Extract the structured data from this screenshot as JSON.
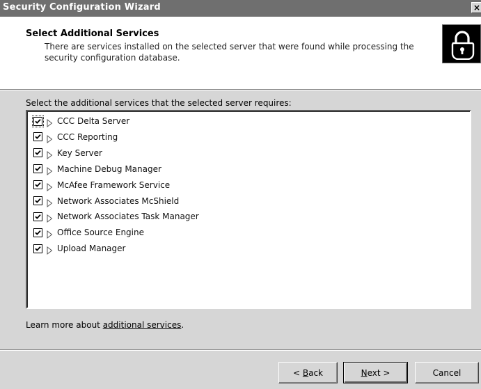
{
  "window": {
    "title": "Security Configuration Wizard",
    "close_glyph": "×"
  },
  "header": {
    "title": "Select Additional Services",
    "description": "There are services installed on the selected server that were found while processing the security configuration database.",
    "icon": "padlock-icon"
  },
  "prompt": "Select the additional services that the selected server requires:",
  "services": [
    {
      "label": "CCC Delta Server",
      "checked": true
    },
    {
      "label": "CCC Reporting",
      "checked": true
    },
    {
      "label": "Key Server",
      "checked": true
    },
    {
      "label": "Machine Debug Manager",
      "checked": true
    },
    {
      "label": "McAfee Framework Service",
      "checked": true
    },
    {
      "label": "Network Associates McShield",
      "checked": true
    },
    {
      "label": "Network Associates Task Manager",
      "checked": true
    },
    {
      "label": "Office Source Engine",
      "checked": true
    },
    {
      "label": "Upload Manager",
      "checked": true
    }
  ],
  "learn_more": {
    "prefix": "Learn more about ",
    "link": "additional services",
    "suffix": "."
  },
  "buttons": {
    "back": {
      "lt": "< ",
      "accel": "B",
      "rest": "ack"
    },
    "next": {
      "accel": "N",
      "rest": "ext >"
    },
    "cancel": "Cancel"
  },
  "colors": {
    "titlebar": "#6f6f6f",
    "dialog_face": "#d6d6d6",
    "header_bg": "#ffffff"
  }
}
